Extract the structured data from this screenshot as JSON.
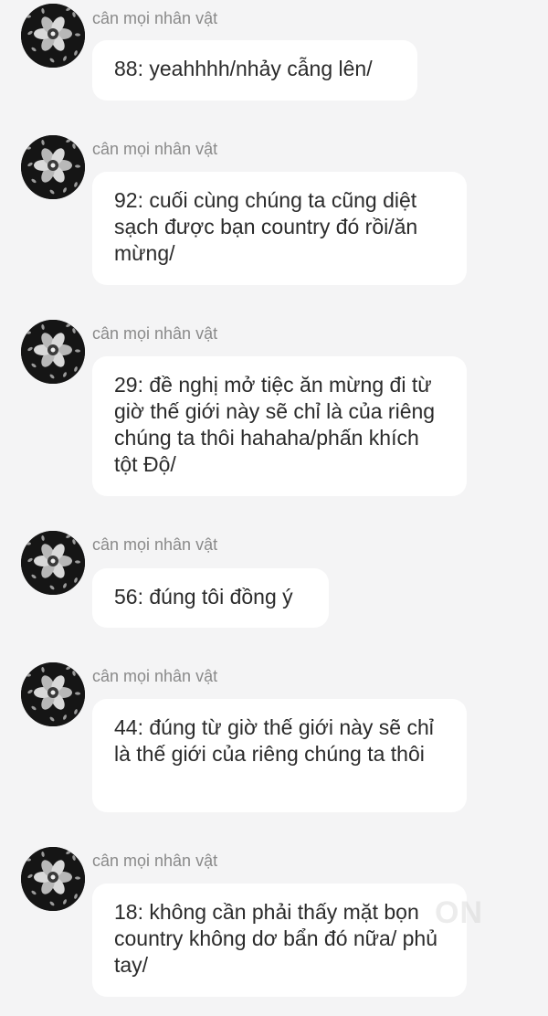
{
  "messages": [
    {
      "sender": "cân mọi nhân vật",
      "text": "88: yeahhhh/nhảy cẫng lên/"
    },
    {
      "sender": "cân mọi nhân vật",
      "text": "92: cuối cùng chúng ta cũng diệt sạch được bạn country đó rồi/ăn mừng/"
    },
    {
      "sender": "cân mọi nhân vật",
      "text": "29: đề nghị mở tiệc ăn mừng đi từ giờ thế giới này sẽ chỉ là của riêng chúng ta thôi hahaha/phấn khích tột Độ/"
    },
    {
      "sender": "cân mọi nhân vật",
      "text": "56: đúng tôi đồng ý"
    },
    {
      "sender": "cân mọi nhân vật",
      "text": "44: đúng từ giờ thế giới này sẽ chỉ là thế giới của riêng chúng ta thôi"
    },
    {
      "sender": "cân mọi nhân vật",
      "text": "18: không cần phải thấy mặt bọn country không dơ bẩn đó nữa/ phủ tay/"
    }
  ],
  "avatar_icon": "flower-avatar-icon",
  "colors": {
    "background": "#f4f4f5",
    "bubble": "#ffffff",
    "sender": "#8a8a8a",
    "text": "#2b2b2b"
  }
}
